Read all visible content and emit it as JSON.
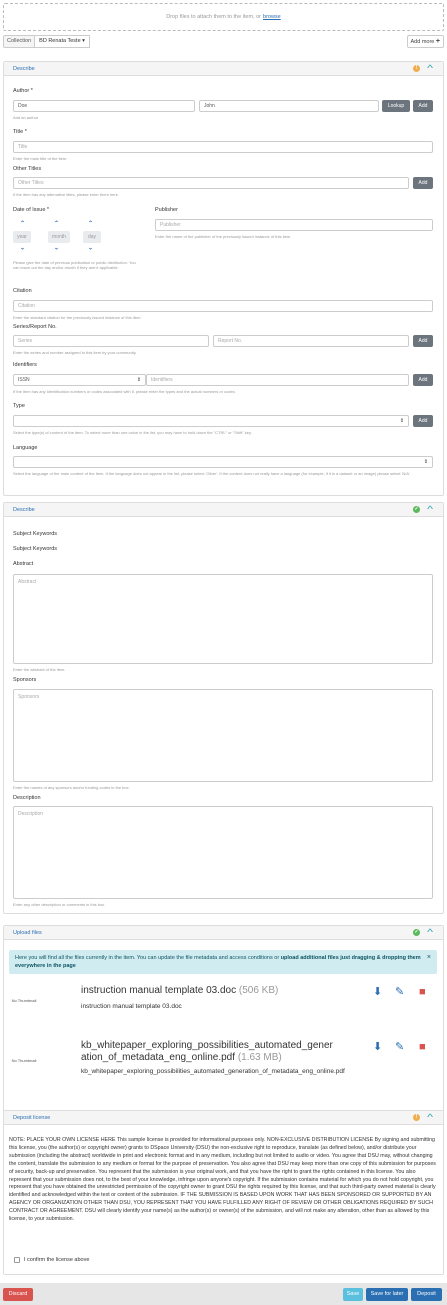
{
  "dropzone": {
    "text": "Drop files to attach them to the item, or",
    "link": "browse"
  },
  "collection": {
    "label": "Collection",
    "value": "BD Renata Teste",
    "add_more": "Add more"
  },
  "describe1": {
    "title": "Describe",
    "author": {
      "label": "Author *",
      "last": "Doe",
      "first": "John",
      "lookup": "Lookup",
      "add": "Add",
      "hint": "Add an author"
    },
    "title_field": {
      "label": "Title *",
      "placeholder": "Title",
      "hint": "Enter the main title of the item."
    },
    "other_titles": {
      "label": "Other Titles",
      "placeholder": "Other Titles",
      "add": "Add",
      "hint": "If the item has any alternative titles, please enter them here."
    },
    "date": {
      "label": "Date of Issue *",
      "year": "year",
      "month": "month",
      "day": "day",
      "hint": "Please give the date of previous publication or public distribution. You can leave out the day and/or month if they aren't applicable."
    },
    "publisher": {
      "label": "Publisher",
      "placeholder": "Publisher",
      "hint": "Enter the name of the publisher of the previously issued instance of this item."
    },
    "citation": {
      "label": "Citation",
      "placeholder": "Citation",
      "hint": "Enter the standard citation for the previously issued instance of this item."
    },
    "series": {
      "label": "Series/Report No.",
      "series_placeholder": "Series",
      "report_placeholder": "Report No.",
      "add": "Add",
      "hint": "Enter the series and number assigned to this item by your community."
    },
    "identifiers": {
      "label": "Identifiers",
      "select": "ISSN",
      "placeholder": "Identifiers",
      "add": "Add",
      "hint": "If the item has any identification numbers or codes associated with it, please enter the types and the actual numbers or codes."
    },
    "type": {
      "label": "Type",
      "add": "Add",
      "hint": "Select the type(s) of content of the item. To select more than one value in the list, you may have to hold down the \"CTRL\" or \"Shift\" key."
    },
    "language": {
      "label": "Language",
      "hint": "Select the language of the main content of the item. If the language does not appear in the list, please select 'Other'. If the content does not really have a language (for example, if it is a dataset or an image) please select 'N/A'."
    }
  },
  "describe2": {
    "title": "Describe",
    "subject1": "Subject Keywords",
    "subject2": "Subject Keywords",
    "abstract": {
      "label": "Abstract",
      "placeholder": "Abstract",
      "hint": "Enter the abstract of the item."
    },
    "sponsors": {
      "label": "Sponsors",
      "placeholder": "Sponsors",
      "hint": "Enter the names of any sponsors and/or funding codes in the box."
    },
    "description": {
      "label": "Description",
      "placeholder": "Description",
      "hint": "Enter any other description or comments in this box."
    }
  },
  "upload": {
    "title": "Upload files",
    "notice_plain": "Here you will find all the files currently in the item. You can update the file metadata and access conditions or",
    "notice_bold": "upload additional files just dragging & dropping them everywhere in the page",
    "files": [
      {
        "thumb": "No Thumbnail",
        "name": "instruction manual template 03.doc",
        "size": "(506 KB)",
        "sub": "instruction manual template 03.doc"
      },
      {
        "thumb": "No Thumbnail",
        "name": "kb_whitepaper_exploring_possibilities_automated_gener ation_of_metadata_eng_online.pdf",
        "size": "(1.63 MB)",
        "sub": "kb_whitepaper_exploring_possibilities_automated_generation_of_metadata_eng_online.pdf"
      }
    ]
  },
  "license": {
    "title": "Deposit license",
    "text": "NOTE: PLACE YOUR OWN LICENSE HERE This sample license is provided for informational purposes only. NON-EXCLUSIVE DISTRIBUTION LICENSE By signing and submitting this license, you (the author(s) or copyright owner) grants to DSpace University (DSU) the non-exclusive right to reproduce, translate (as defined below), and/or distribute your submission (including the abstract) worldwide in print and electronic format and in any medium, including but not limited to audio or video. You agree that DSU may, without changing the content, translate the submission to any medium or format for the purpose of preservation. You also agree that DSU may keep more than one copy of this submission for purposes of security, back-up and preservation. You represent that the submission is your original work, and that you have the right to grant the rights contained in this license. You also represent that your submission does not, to the best of your knowledge, infringe upon anyone's copyright. If the submission contains material for which you do not hold copyright, you represent that you have obtained the unrestricted permission of the copyright owner to grant DSU the rights required by this license, and that such third-party owned material is clearly identified and acknowledged within the text or content of the submission. IF THE SUBMISSION IS BASED UPON WORK THAT HAS BEEN SPONSORED OR SUPPORTED BY AN AGENCY OR ORGANIZATION OTHER THAN DSU, YOU REPRESENT THAT YOU HAVE FULFILLED ANY RIGHT OF REVIEW OR OTHER OBLIGATIONS REQUIRED BY SUCH CONTRACT OR AGREEMENT. DSU will clearly identify your name(s) as the author(s) or owner(s) of the submission, and will not make any alteration, other than as allowed by this license, to your submission.",
    "confirm": "I confirm the license above"
  },
  "footer": {
    "discard": "Discard",
    "save": "Save",
    "save_later": "Save for later",
    "deposit": "Deposit"
  },
  "colors": {
    "accent": "#2b6fb3",
    "warning": "#f0ad4e",
    "success": "#5cb85c",
    "danger": "#d9534f",
    "info": "#5bc0de",
    "teal": "#34a6b8"
  }
}
